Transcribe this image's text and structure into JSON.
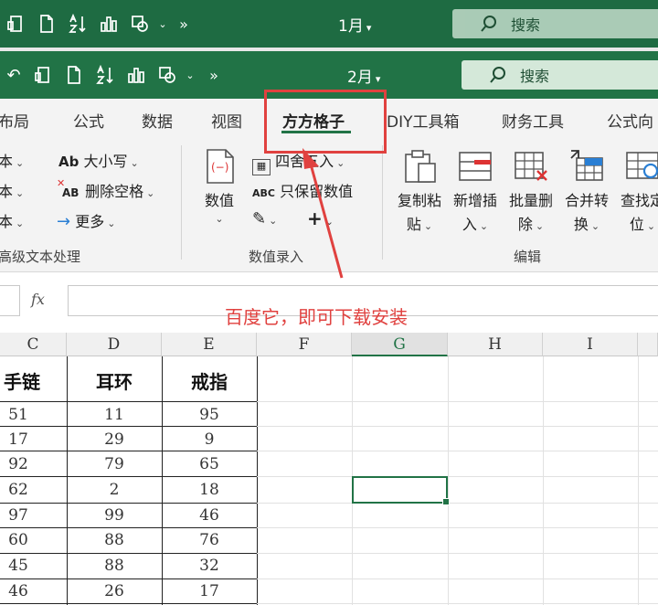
{
  "window_back": {
    "file_name": "1月",
    "search_label": "搜索"
  },
  "window_front": {
    "file_name": "2月",
    "search_label": "搜索"
  },
  "quick_access": {
    "more": "»"
  },
  "tabs": [
    {
      "label": "布局"
    },
    {
      "label": "公式"
    },
    {
      "label": "数据"
    },
    {
      "label": "视图"
    },
    {
      "label": "方方格子"
    },
    {
      "label": "DIY工具箱"
    },
    {
      "label": "财务工具"
    },
    {
      "label": "公式向"
    }
  ],
  "ribbon": {
    "text_group": {
      "left_items": [
        "本",
        "本",
        "本"
      ],
      "case_label": "大小写",
      "case_icon_text": "Ab",
      "delete_space_label": "删除空格",
      "delete_space_icon_text": "AB",
      "more_label": "更多",
      "group_label": "高级文本处理"
    },
    "number_group": {
      "value_label": "数值",
      "round_label": "四舍五入",
      "keep_number_label": "只保留数值",
      "keep_number_icon_text": "ABC",
      "plus": "+",
      "group_label": "数值录入"
    },
    "edit_group": {
      "buttons": [
        {
          "line1": "复制粘",
          "line2": "贴"
        },
        {
          "line1": "新增插",
          "line2": "入"
        },
        {
          "line1": "批量删",
          "line2": "除"
        },
        {
          "line1": "合并转",
          "line2": "换"
        },
        {
          "line1": "查找定",
          "line2": "位"
        }
      ],
      "group_label": "编辑"
    }
  },
  "formula_bar": {
    "fx": "fx",
    "value": ""
  },
  "annotation": "百度它，即可下载安装",
  "grid": {
    "columns": [
      "C",
      "D",
      "E",
      "F",
      "G",
      "H",
      "I"
    ],
    "selected_column": "G",
    "headers": [
      "手链",
      "耳环",
      "戒指"
    ],
    "rows": [
      [
        "51",
        "11",
        "95"
      ],
      [
        "17",
        "29",
        "9"
      ],
      [
        "92",
        "79",
        "65"
      ],
      [
        "62",
        "2",
        "18"
      ],
      [
        "97",
        "99",
        "46"
      ],
      [
        "60",
        "88",
        "76"
      ],
      [
        "45",
        "88",
        "32"
      ],
      [
        "46",
        "26",
        "17"
      ]
    ]
  },
  "colors": {
    "excel_green": "#217346",
    "annotation_red": "#e0413f"
  }
}
